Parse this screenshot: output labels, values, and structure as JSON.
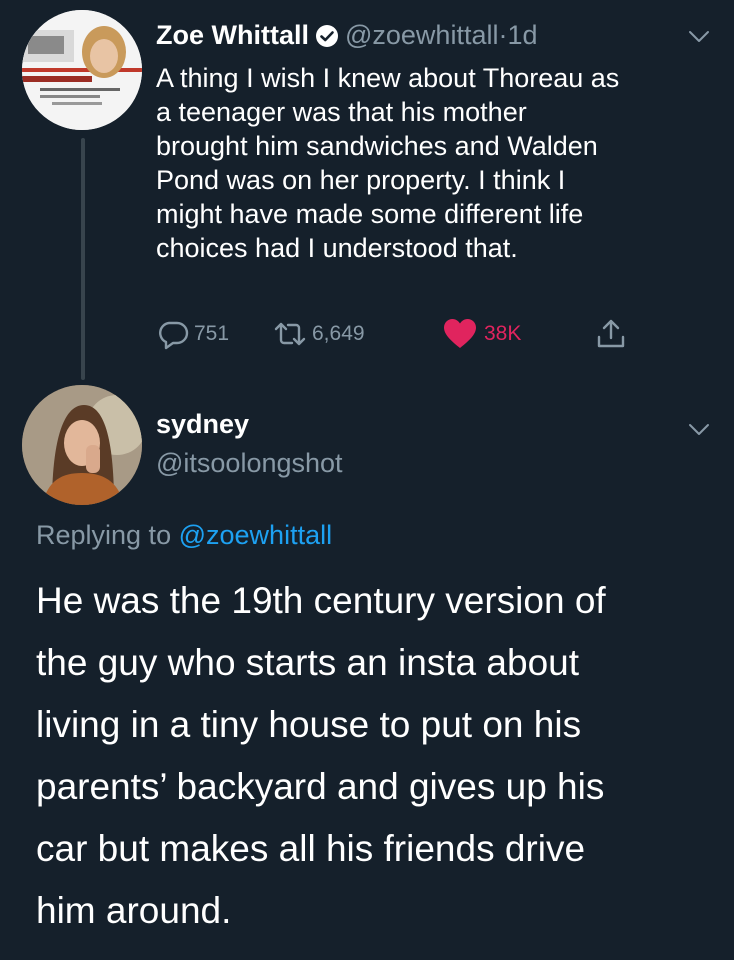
{
  "tweet": {
    "author_name": "Zoe Whittall",
    "verified_icon": "verified-badge-icon",
    "handle": "@zoewhittall",
    "separator": "·",
    "time": "1d",
    "text": "A thing I wish I knew about Thoreau as\na teenager was that his mother\nbrought him sandwiches and Walden\nPond was on her property. I think I\nmight have made some different life\nchoices had I understood that.",
    "replies": "751",
    "retweets": "6,649",
    "likes": "38K",
    "liked": true,
    "colors": {
      "like": "#e0245e",
      "muted": "#8899a6",
      "background": "#15202b",
      "link": "#1da1f2"
    }
  },
  "reply": {
    "author_name": "sydney",
    "handle": "@itsoolongshot",
    "replying_to_prefix": "Replying to",
    "replying_to_handle": "@zoewhittall",
    "text": "He was the 19th century version of\nthe guy who starts an insta about\nliving in a tiny house to put on his\nparents’ backyard and gives up his\ncar but makes all his friends drive\nhim around."
  }
}
